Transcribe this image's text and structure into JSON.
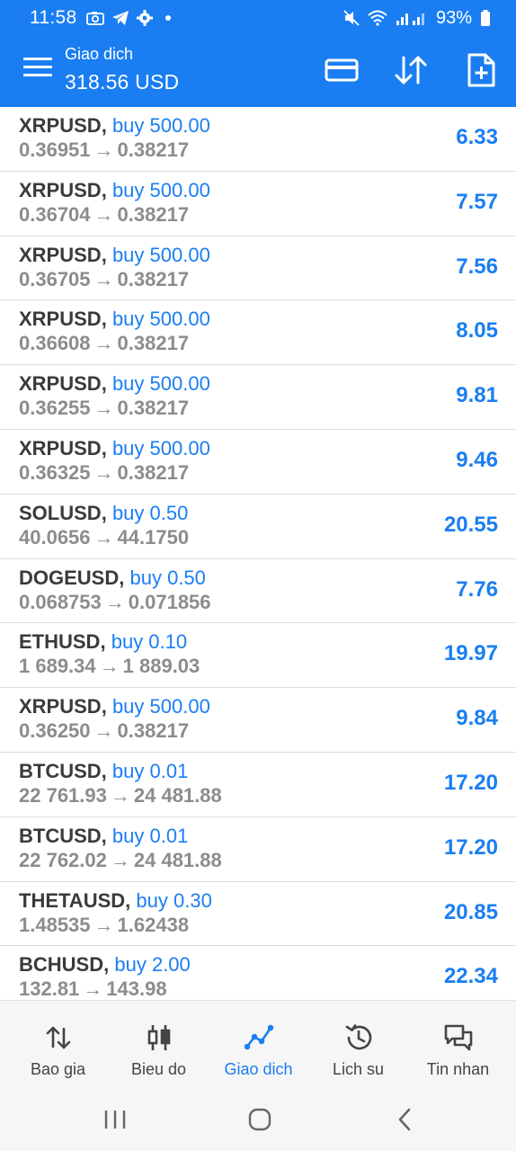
{
  "status_bar": {
    "time": "11:58",
    "battery": "93%"
  },
  "header": {
    "title": "Giao dich",
    "balance": "318.56 USD"
  },
  "colors": {
    "accent": "#1a7ef2",
    "text_dark": "#3a3a3a",
    "text_gray": "#8c8c8c"
  },
  "icons": {
    "header": [
      "menu-icon",
      "card-icon",
      "sort-icon",
      "new-order-icon"
    ],
    "status": [
      "screenshot-icon",
      "telegram-icon",
      "settings-icon",
      "mute-icon",
      "wifi-icon",
      "signal-icon",
      "battery-icon"
    ]
  },
  "positions": [
    {
      "symbol": "XRPUSD",
      "side": "buy 500.00",
      "open": "0.36951",
      "current": "0.38217",
      "profit": "6.33"
    },
    {
      "symbol": "XRPUSD",
      "side": "buy 500.00",
      "open": "0.36704",
      "current": "0.38217",
      "profit": "7.57"
    },
    {
      "symbol": "XRPUSD",
      "side": "buy 500.00",
      "open": "0.36705",
      "current": "0.38217",
      "profit": "7.56"
    },
    {
      "symbol": "XRPUSD",
      "side": "buy 500.00",
      "open": "0.36608",
      "current": "0.38217",
      "profit": "8.05"
    },
    {
      "symbol": "XRPUSD",
      "side": "buy 500.00",
      "open": "0.36255",
      "current": "0.38217",
      "profit": "9.81"
    },
    {
      "symbol": "XRPUSD",
      "side": "buy 500.00",
      "open": "0.36325",
      "current": "0.38217",
      "profit": "9.46"
    },
    {
      "symbol": "SOLUSD",
      "side": "buy 0.50",
      "open": "40.0656",
      "current": "44.1750",
      "profit": "20.55"
    },
    {
      "symbol": "DOGEUSD",
      "side": "buy 0.50",
      "open": "0.068753",
      "current": "0.071856",
      "profit": "7.76"
    },
    {
      "symbol": "ETHUSD",
      "side": "buy 0.10",
      "open": "1 689.34",
      "current": "1 889.03",
      "profit": "19.97"
    },
    {
      "symbol": "XRPUSD",
      "side": "buy 500.00",
      "open": "0.36250",
      "current": "0.38217",
      "profit": "9.84"
    },
    {
      "symbol": "BTCUSD",
      "side": "buy 0.01",
      "open": "22 761.93",
      "current": "24 481.88",
      "profit": "17.20"
    },
    {
      "symbol": "BTCUSD",
      "side": "buy 0.01",
      "open": "22 762.02",
      "current": "24 481.88",
      "profit": "17.20"
    },
    {
      "symbol": "THETAUSD",
      "side": "buy 0.30",
      "open": "1.48535",
      "current": "1.62438",
      "profit": "20.85"
    },
    {
      "symbol": "BCHUSD",
      "side": "buy 2.00",
      "open": "132.81",
      "current": "143.98",
      "profit": "22.34"
    }
  ],
  "arrow": "→",
  "comma": ",",
  "bottom_nav": {
    "items": [
      {
        "label": "Bao gia",
        "icon": "quotes-icon"
      },
      {
        "label": "Bieu do",
        "icon": "chart-icon"
      },
      {
        "label": "Giao dich",
        "icon": "trade-icon",
        "active": true
      },
      {
        "label": "Lich su",
        "icon": "history-icon"
      },
      {
        "label": "Tin nhan",
        "icon": "messages-icon"
      }
    ]
  }
}
